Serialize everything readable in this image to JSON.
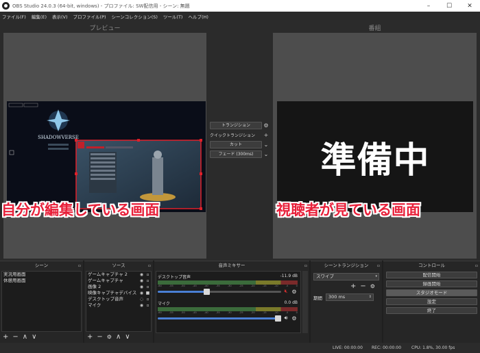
{
  "window": {
    "title": "OBS Studio 24.0.3 (64-bit, windows) - プロファイル: SW配信用 - シーン: 無題",
    "minimize": "–",
    "maximize": "☐",
    "close": "✕"
  },
  "menu": [
    "ファイル(F)",
    "編集(E)",
    "表示(V)",
    "プロファイル(P)",
    "シーンコレクション(S)",
    "ツール(T)",
    "ヘルプ(H)"
  ],
  "preview": {
    "label": "プレビュー",
    "overlay": "自分が編集している画面",
    "game_logo": "SHADOWVERSE"
  },
  "program": {
    "label": "番組",
    "screen_text": "準備中",
    "overlay": "視聴者が見ている画面"
  },
  "transition_panel": {
    "transition_button": "トランジション",
    "quick_transition": "クイックトランジション",
    "cut": "カット",
    "fade": "フェード (300ms)"
  },
  "scenes": {
    "title": "シーン",
    "items": [
      "実況用画面",
      "休憩用画面"
    ]
  },
  "sources": {
    "title": "ソース",
    "items": [
      "ゲームキャプチャ 2",
      "ゲームキャプチャ",
      "画像 2",
      "映像キャプチャデバイス",
      "デスクトップ音声",
      "マイク"
    ]
  },
  "mixer": {
    "title": "音声ミキサー",
    "channels": [
      {
        "name": "デスクトップ音声",
        "db": "-11.9 dB",
        "volume": 0.42,
        "muted": true
      },
      {
        "name": "マイク",
        "db": "0.0 dB",
        "volume": 1.0,
        "muted": false
      }
    ],
    "ticks": [
      "-60",
      "-55",
      "-50",
      "-45",
      "-40",
      "-35",
      "-30",
      "-25",
      "-20",
      "-15",
      "-10",
      "-5",
      "0"
    ]
  },
  "scene_transitions": {
    "title": "シーントランジション",
    "selected": "スワイプ",
    "duration_label": "期間",
    "duration_value": "300 ms"
  },
  "controls": {
    "title": "コントロール",
    "buttons": [
      "配信開始",
      "録画開始",
      "スタジオモード",
      "設定",
      "終了"
    ]
  },
  "status": {
    "live": "LIVE: 00:00:00",
    "rec": "REC: 00:00:00",
    "cpu": "CPU: 1.8%, 30.00 fps"
  },
  "colors": {
    "overlay_text": "#e8203a",
    "selection_box": "#e0202a",
    "volume_fill": "#4a7fd4",
    "mute_icon": "#e03030"
  }
}
